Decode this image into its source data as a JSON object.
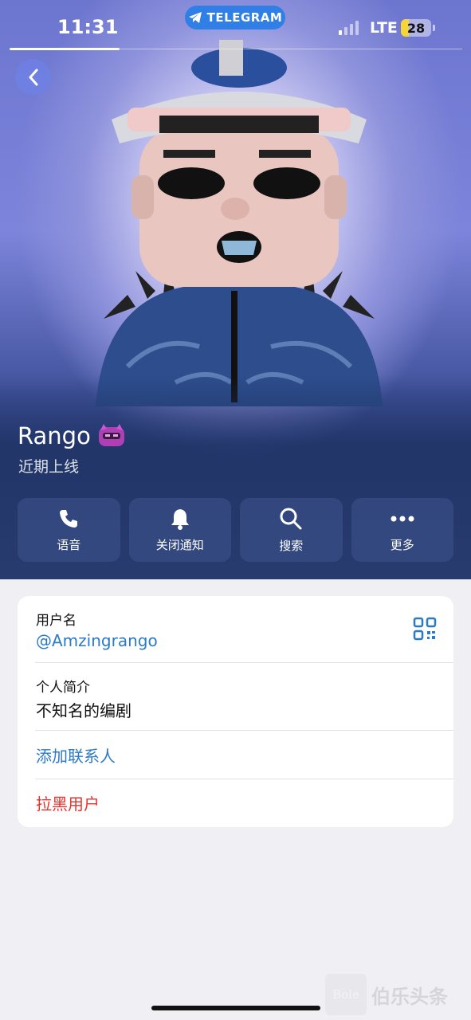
{
  "status_bar": {
    "time": "11:31",
    "app_pill": "TELEGRAM",
    "network": "LTE",
    "battery": "28"
  },
  "profile": {
    "name": "Rango",
    "status": "近期上线"
  },
  "actions": [
    {
      "label": "语音",
      "icon": "phone-icon"
    },
    {
      "label": "关闭通知",
      "icon": "bell-icon"
    },
    {
      "label": "搜索",
      "icon": "search-icon"
    },
    {
      "label": "更多",
      "icon": "more-icon"
    }
  ],
  "info": {
    "username_label": "用户名",
    "username": "@Amzingrango",
    "bio_label": "个人简介",
    "bio": "不知名的编剧",
    "add_contact": "添加联系人",
    "block_user": "拉黑用户"
  },
  "colors": {
    "accent": "#2a7ac8",
    "danger": "#e5322d",
    "background": "#efeff4"
  }
}
